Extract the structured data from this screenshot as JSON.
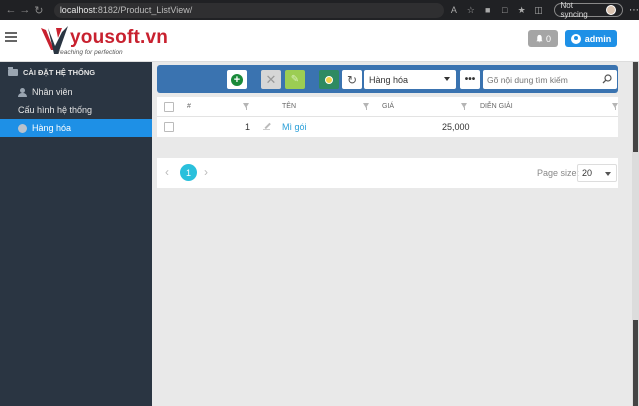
{
  "browser": {
    "url_host": "localhost",
    "url_path": ":8182/Product_ListView/",
    "sync_label": "Not syncing"
  },
  "header": {
    "brand": "yousoft.vn",
    "tagline": "reaching for perfection",
    "notifications_count": "0",
    "user_label": "admin"
  },
  "sidebar": {
    "section_label": "CÀI ĐẶT HỆ THỐNG",
    "items": [
      {
        "label": "Nhân viên"
      },
      {
        "label": "Cấu hình hệ thống"
      },
      {
        "label": "Hàng hóa"
      }
    ]
  },
  "toolbar": {
    "category_selected": "Hàng hóa",
    "more_label": "•••",
    "search_placeholder": "Gõ nội dung tìm kiếm"
  },
  "table": {
    "columns": [
      "#",
      "TÊN",
      "GIÁ",
      "DIỄN GIẢI"
    ],
    "rows": [
      {
        "index": "1",
        "name": "Mì gói",
        "price": "25,000",
        "description": ""
      }
    ]
  },
  "pager": {
    "current_page": "1",
    "page_size_label": "Page size:",
    "page_size": "20"
  },
  "colors": {
    "toolbar_bg": "#3a73b0",
    "accent": "#1e90e6",
    "sidebar_bg": "#2a3542",
    "brand_red": "#c8212f"
  }
}
